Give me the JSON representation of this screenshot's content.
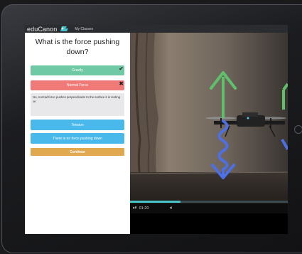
{
  "app": {
    "brand": "eduCanon",
    "brand_icon": "flag-logo-icon",
    "nav_label": "My Classes"
  },
  "quiz": {
    "question": "What is the force pushing down?",
    "answers": [
      {
        "label": "Gravity",
        "state": "correct",
        "color": "#6fc9a5",
        "icon": "checkmark-icon"
      },
      {
        "label": "Normal Force",
        "state": "incorrect",
        "color": "#f07a78",
        "icon": "close-icon"
      },
      {
        "label": "Tension",
        "state": "neutral",
        "color": "#49b9ec"
      },
      {
        "label": "There is no force pushing down",
        "state": "neutral",
        "color": "#49b9ec"
      }
    ],
    "feedback": "No, normal force pushes perpendicular to the surface it is resting on",
    "continue_label": "Continue",
    "continue_color": "#e0a84f"
  },
  "player": {
    "time": "01:20",
    "progress_fraction": 0.32,
    "play_icon": "play-icon",
    "volume_icon": "volume-icon"
  }
}
